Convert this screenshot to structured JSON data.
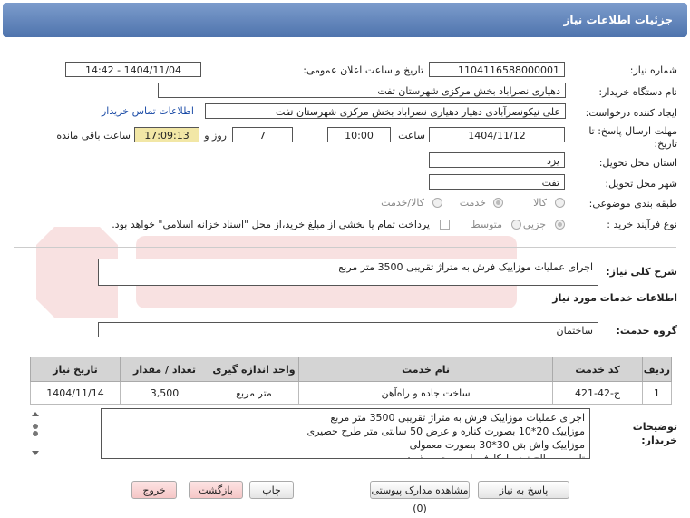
{
  "header": {
    "title": "جزئیات اطلاعات نیاز"
  },
  "fields": {
    "need_number_label": "شماره نیاز:",
    "need_number": "1104116588000001",
    "announce_label": "تاریخ و ساعت اعلان عمومی:",
    "announce_value": "1404/11/04 - 14:42",
    "buyer_label": "نام دستگاه خریدار:",
    "buyer": "دهیاری نصراباد بخش مرکزی شهرستان تفت",
    "creator_label": "ایجاد کننده درخواست:",
    "creator": "علی نیکونصرآبادی دهیار دهیاری نصراباد بخش مرکزی شهرستان تفت",
    "contact_link": "اطلاعات تماس خریدار",
    "deadline_label": "مهلت ارسال پاسخ: تا تاریخ:",
    "deadline_date": "1404/11/12",
    "time_label": "ساعت",
    "deadline_time": "10:00",
    "days_value": "7",
    "days_label": "روز و",
    "remaining_time": "17:09:13",
    "remaining_label": "ساعت باقی مانده",
    "province_label": "استان محل تحویل:",
    "province": "یزد",
    "city_label": "شهر محل تحویل:",
    "city": "تفت",
    "category_label": "طبقه بندی موضوعی:",
    "category_options": [
      "کالا",
      "خدمت",
      "کالا/خدمت"
    ],
    "category_selected": "خدمت",
    "process_label": "نوع فرآیند خرید :",
    "process_options": [
      "جزیی",
      "متوسط"
    ],
    "process_selected": "جزیی",
    "process_note": "پرداخت تمام یا بخشی از مبلغ خرید،از محل \"اسناد خزانه اسلامی\" خواهد بود."
  },
  "summary": {
    "label": "شرح کلی نیاز:",
    "value": "اجرای عملیات موزاییک فرش به متراژ تقریبی 3500 متر مربع"
  },
  "services": {
    "title": "اطلاعات خدمات مورد نیاز",
    "group_label": "گروه خدمت:",
    "group_value": "ساختمان",
    "columns": [
      "ردیف",
      "کد خدمت",
      "نام خدمت",
      "واحد اندازه گیری",
      "تعداد / مقدار",
      "تاریخ نیاز"
    ],
    "rows": [
      [
        "1",
        "ج-42-421",
        "ساخت جاده و راه‌آهن",
        "متر مربع",
        "3,500",
        "1404/11/14"
      ]
    ]
  },
  "notes": {
    "label": "توضیحات خریدار:",
    "lines": [
      "اجرای عملیات موزاییک فرش به متراژ تقریبی 3500 متر مربع",
      "موزاییک 20*10 بصورت کناره و عرض 50 سانتی متر طرح حصیری",
      "موزاییک واش بتن 30*30 بصورت معمولی",
      "تامین مصالح توسط کارفرما صورت میپذیرد"
    ]
  },
  "buttons": {
    "reply": "پاسخ به نیاز",
    "attachments": "مشاهده مدارک پیوستی (0)",
    "print": "چاپ",
    "back": "بازگشت",
    "exit": "خروج"
  },
  "colors": {
    "header_bg": "#5b7fb8",
    "link": "#1e4ea8",
    "highlight": "#f2e7a6"
  }
}
